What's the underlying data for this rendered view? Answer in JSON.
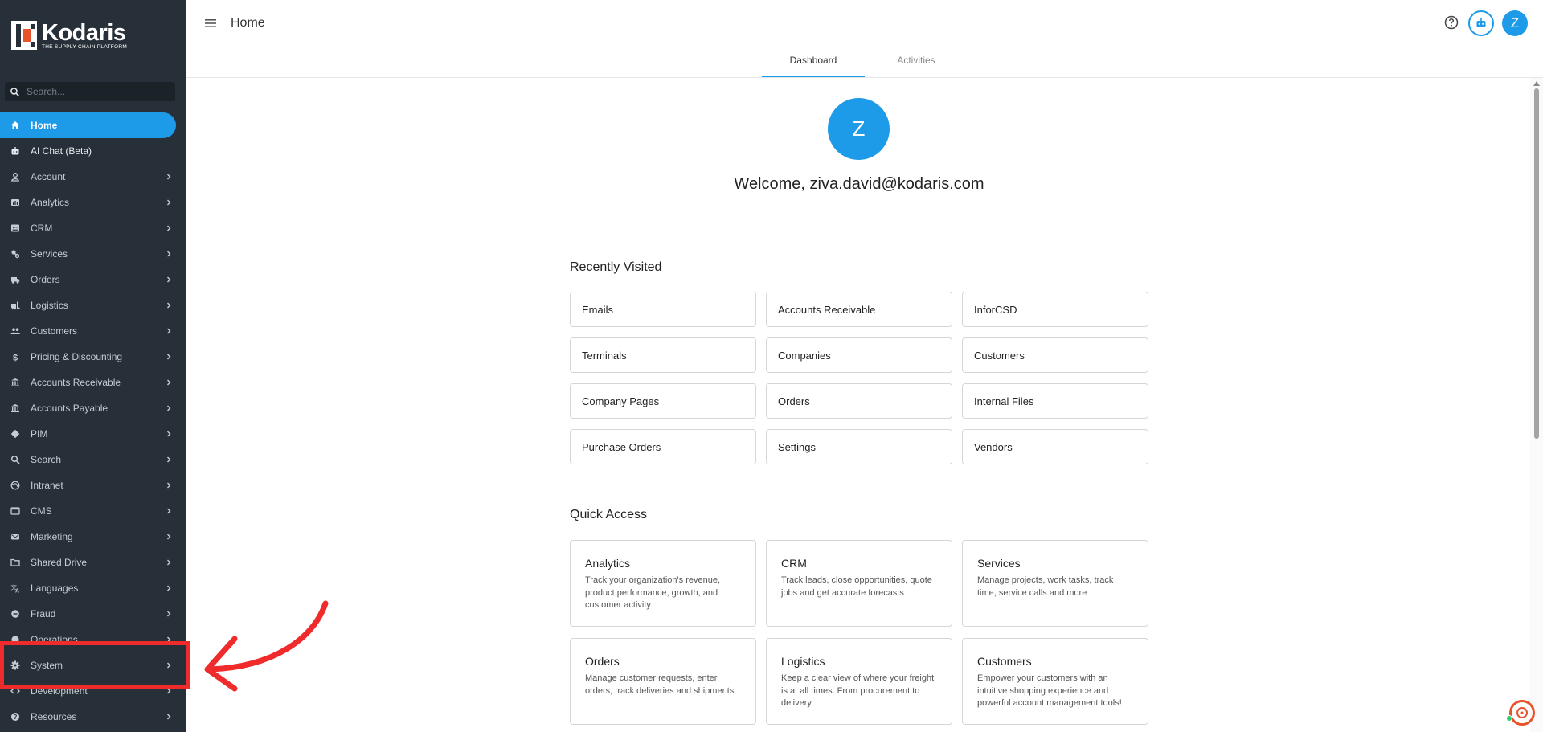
{
  "brand": {
    "name": "Kodaris",
    "tagline": "THE SUPPLY CHAIN PLATFORM",
    "accent": "#1d9be8",
    "sidebar_bg": "#273038",
    "highlight": "#ef2b2b",
    "logo_orange": "#e8542c"
  },
  "sidebar": {
    "search_placeholder": "Search...",
    "items": [
      {
        "label": "Home",
        "icon": "home-icon",
        "active": true,
        "chevron": false
      },
      {
        "label": "AI Chat (Beta)",
        "icon": "robot-icon",
        "active": false,
        "chevron": false
      },
      {
        "label": "Account",
        "icon": "person-icon",
        "chevron": true
      },
      {
        "label": "Analytics",
        "icon": "chart-icon",
        "chevron": true
      },
      {
        "label": "CRM",
        "icon": "contact-card-icon",
        "chevron": true
      },
      {
        "label": "Services",
        "icon": "wrench-icon",
        "chevron": true
      },
      {
        "label": "Orders",
        "icon": "truck-icon",
        "chevron": true
      },
      {
        "label": "Logistics",
        "icon": "forklift-icon",
        "chevron": true
      },
      {
        "label": "Customers",
        "icon": "people-icon",
        "chevron": true
      },
      {
        "label": "Pricing & Discounting",
        "icon": "dollar-icon",
        "chevron": true
      },
      {
        "label": "Accounts Receivable",
        "icon": "bank-icon",
        "chevron": true
      },
      {
        "label": "Accounts Payable",
        "icon": "bank-icon",
        "chevron": true
      },
      {
        "label": "PIM",
        "icon": "tag-icon",
        "chevron": true
      },
      {
        "label": "Search",
        "icon": "search-icon",
        "chevron": true
      },
      {
        "label": "Intranet",
        "icon": "globe-icon",
        "chevron": true
      },
      {
        "label": "CMS",
        "icon": "browser-icon",
        "chevron": true
      },
      {
        "label": "Marketing",
        "icon": "mail-icon",
        "chevron": true
      },
      {
        "label": "Shared Drive",
        "icon": "folder-icon",
        "chevron": true
      },
      {
        "label": "Languages",
        "icon": "translate-icon",
        "chevron": true
      },
      {
        "label": "Fraud",
        "icon": "shield-icon",
        "chevron": true
      },
      {
        "label": "Operations",
        "icon": "cog-icon",
        "chevron": true
      },
      {
        "label": "System",
        "icon": "gear-icon",
        "chevron": true
      },
      {
        "label": "Development",
        "icon": "code-icon",
        "chevron": true
      },
      {
        "label": "Resources",
        "icon": "help-icon",
        "chevron": true
      }
    ]
  },
  "header": {
    "title": "Home",
    "avatar_initial": "Z"
  },
  "tabs": [
    {
      "label": "Dashboard",
      "active": true
    },
    {
      "label": "Activities",
      "active": false
    }
  ],
  "profile": {
    "initial": "Z",
    "welcome": "Welcome, ziva.david@kodaris.com"
  },
  "recently_visited": {
    "title": "Recently Visited",
    "items": [
      "Emails",
      "Accounts Receivable",
      "InforCSD",
      "Terminals",
      "Companies",
      "Customers",
      "Company Pages",
      "Orders",
      "Internal Files",
      "Purchase Orders",
      "Settings",
      "Vendors"
    ]
  },
  "quick_access": {
    "title": "Quick Access",
    "items": [
      {
        "title": "Analytics",
        "desc": "Track your organization's revenue, product performance, growth, and customer activity"
      },
      {
        "title": "CRM",
        "desc": "Track leads, close opportunities, quote jobs and get accurate forecasts"
      },
      {
        "title": "Services",
        "desc": "Manage projects, work tasks, track time, service calls and more"
      },
      {
        "title": "Orders",
        "desc": "Manage customer requests, enter orders, track deliveries and shipments"
      },
      {
        "title": "Logistics",
        "desc": "Keep a clear view of where your freight is at all times. From procurement to delivery."
      },
      {
        "title": "Customers",
        "desc": "Empower your customers with an intuitive shopping experience and powerful account management tools!"
      }
    ]
  }
}
